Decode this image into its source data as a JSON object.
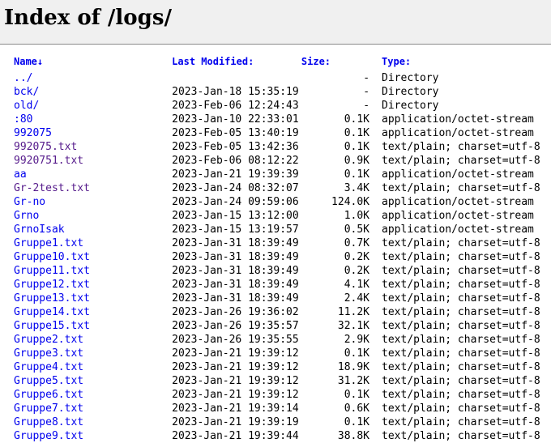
{
  "title": "Index of /logs/",
  "columns": {
    "name": "Name↓",
    "modified": "Last Modified:",
    "size": "Size:",
    "type": "Type:"
  },
  "rows": [
    {
      "name": "../",
      "date": "",
      "size": "-",
      "type": "Directory",
      "visited": false
    },
    {
      "name": "bck/",
      "date": "2023-Jan-18 15:35:19",
      "size": "-",
      "type": "Directory",
      "visited": false
    },
    {
      "name": "old/",
      "date": "2023-Feb-06 12:24:43",
      "size": "-",
      "type": "Directory",
      "visited": false
    },
    {
      "name": ":80",
      "date": "2023-Jan-10 22:33:01",
      "size": "0.1K",
      "type": "application/octet-stream",
      "visited": false
    },
    {
      "name": "992075",
      "date": "2023-Feb-05 13:40:19",
      "size": "0.1K",
      "type": "application/octet-stream",
      "visited": false
    },
    {
      "name": "992075.txt",
      "date": "2023-Feb-05 13:42:36",
      "size": "0.1K",
      "type": "text/plain; charset=utf-8",
      "visited": true
    },
    {
      "name": "9920751.txt",
      "date": "2023-Feb-06 08:12:22",
      "size": "0.9K",
      "type": "text/plain; charset=utf-8",
      "visited": true
    },
    {
      "name": "aa",
      "date": "2023-Jan-21 19:39:39",
      "size": "0.1K",
      "type": "application/octet-stream",
      "visited": false
    },
    {
      "name": "Gr-2test.txt",
      "date": "2023-Jan-24 08:32:07",
      "size": "3.4K",
      "type": "text/plain; charset=utf-8",
      "visited": true
    },
    {
      "name": "Gr-no",
      "date": "2023-Jan-24 09:59:06",
      "size": "124.0K",
      "type": "application/octet-stream",
      "visited": false
    },
    {
      "name": "Grno",
      "date": "2023-Jan-15 13:12:00",
      "size": "1.0K",
      "type": "application/octet-stream",
      "visited": false
    },
    {
      "name": "GrnoIsak",
      "date": "2023-Jan-15 13:19:57",
      "size": "0.5K",
      "type": "application/octet-stream",
      "visited": false
    },
    {
      "name": "Gruppe1.txt",
      "date": "2023-Jan-31 18:39:49",
      "size": "0.7K",
      "type": "text/plain; charset=utf-8",
      "visited": false
    },
    {
      "name": "Gruppe10.txt",
      "date": "2023-Jan-31 18:39:49",
      "size": "0.2K",
      "type": "text/plain; charset=utf-8",
      "visited": false
    },
    {
      "name": "Gruppe11.txt",
      "date": "2023-Jan-31 18:39:49",
      "size": "0.2K",
      "type": "text/plain; charset=utf-8",
      "visited": false
    },
    {
      "name": "Gruppe12.txt",
      "date": "2023-Jan-31 18:39:49",
      "size": "4.1K",
      "type": "text/plain; charset=utf-8",
      "visited": false
    },
    {
      "name": "Gruppe13.txt",
      "date": "2023-Jan-31 18:39:49",
      "size": "2.4K",
      "type": "text/plain; charset=utf-8",
      "visited": false
    },
    {
      "name": "Gruppe14.txt",
      "date": "2023-Jan-26 19:36:02",
      "size": "11.2K",
      "type": "text/plain; charset=utf-8",
      "visited": false
    },
    {
      "name": "Gruppe15.txt",
      "date": "2023-Jan-26 19:35:57",
      "size": "32.1K",
      "type": "text/plain; charset=utf-8",
      "visited": false
    },
    {
      "name": "Gruppe2.txt",
      "date": "2023-Jan-26 19:35:55",
      "size": "2.9K",
      "type": "text/plain; charset=utf-8",
      "visited": false
    },
    {
      "name": "Gruppe3.txt",
      "date": "2023-Jan-21 19:39:12",
      "size": "0.1K",
      "type": "text/plain; charset=utf-8",
      "visited": false
    },
    {
      "name": "Gruppe4.txt",
      "date": "2023-Jan-21 19:39:12",
      "size": "18.9K",
      "type": "text/plain; charset=utf-8",
      "visited": false
    },
    {
      "name": "Gruppe5.txt",
      "date": "2023-Jan-21 19:39:12",
      "size": "31.2K",
      "type": "text/plain; charset=utf-8",
      "visited": false
    },
    {
      "name": "Gruppe6.txt",
      "date": "2023-Jan-21 19:39:12",
      "size": "0.1K",
      "type": "text/plain; charset=utf-8",
      "visited": false
    },
    {
      "name": "Gruppe7.txt",
      "date": "2023-Jan-21 19:39:14",
      "size": "0.6K",
      "type": "text/plain; charset=utf-8",
      "visited": false
    },
    {
      "name": "Gruppe8.txt",
      "date": "2023-Jan-21 19:39:19",
      "size": "0.1K",
      "type": "text/plain; charset=utf-8",
      "visited": false
    },
    {
      "name": "Gruppe9.txt",
      "date": "2023-Jan-21 19:39:44",
      "size": "38.8K",
      "type": "text/plain; charset=utf-8",
      "visited": false
    }
  ]
}
